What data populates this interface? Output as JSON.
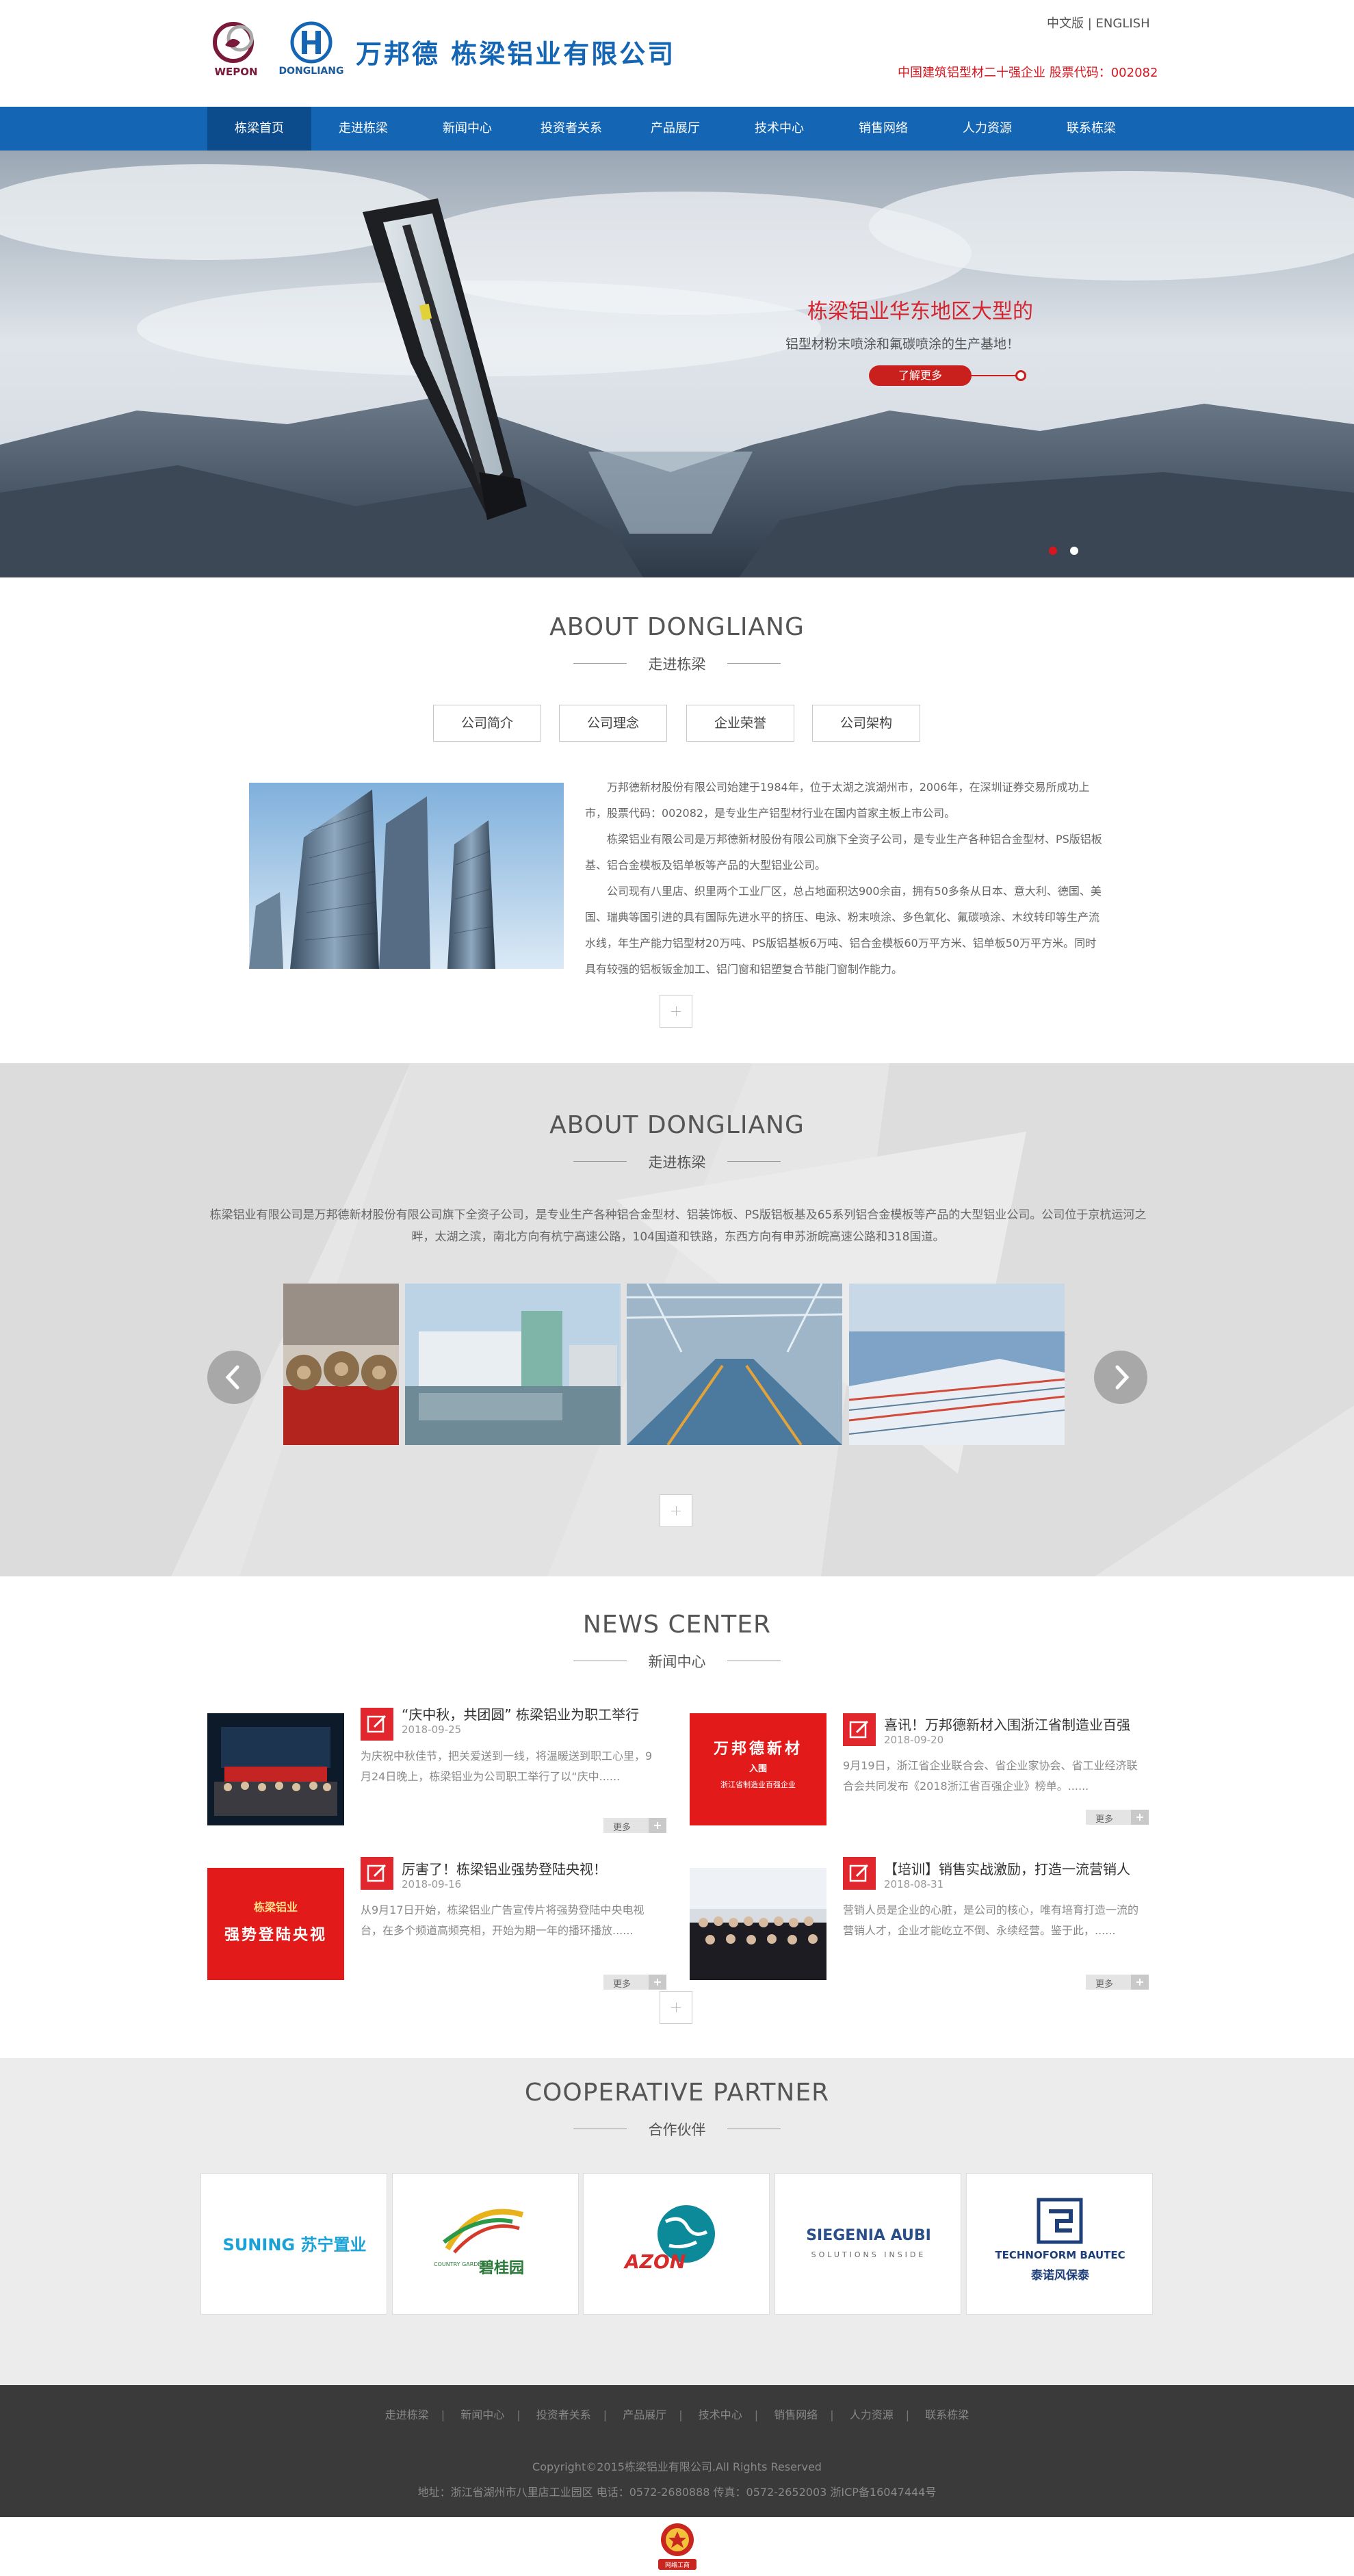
{
  "header": {
    "logo_wepon_text": "WEPON",
    "logo_dongliang_text": "DONGLIANG",
    "brand_text": "万邦德  栋梁铝业有限公司",
    "lang_cn": "中文版",
    "lang_sep": "|",
    "lang_en": "ENGLISH",
    "stock_text": "中国建筑铝型材二十强企业 股票代码：002082"
  },
  "nav": {
    "items": [
      "栋梁首页",
      "走进栋梁",
      "新闻中心",
      "投资者关系",
      "产品展厅",
      "技术中心",
      "销售网络",
      "人力资源",
      "联系栋梁"
    ],
    "active_index": 0
  },
  "banner": {
    "title": "栋梁铝业华东地区大型的",
    "subtitle": "铝型材粉末喷涂和氟碳喷涂的生产基地！",
    "button_label": "了解更多",
    "slide_count": 2,
    "active_slide": 1
  },
  "about": {
    "title_en": "ABOUT DONGLIANG",
    "title_cn": "走进栋梁",
    "tabs": [
      "公司简介",
      "公司理念",
      "企业荣誉",
      "公司架构"
    ],
    "paragraphs": [
      "万邦德新材股份有限公司始建于1984年，位于太湖之滨湖州市，2006年，在深圳证券交易所成功上市，股票代码：002082，是专业生产铝型材行业在国内首家主板上市公司。",
      "栋梁铝业有限公司是万邦德新材股份有限公司旗下全资子公司，是专业生产各种铝合金型材、PS版铝板基、铝合金模板及铝单板等产品的大型铝业公司。",
      "公司现有八里店、织里两个工业厂区，总占地面积达900余亩，拥有50多条从日本、意大利、德国、美国、瑞典等国引进的具有国际先进水平的挤压、电泳、粉末喷涂、多色氧化、氟碳喷涂、木纹转印等生产流水线，年生产能力铝型材20万吨、PS版铝基板6万吨、铝合金模板60万平方米、铝单板50万平方米。同时具有较强的铝板钣金加工、铝门窗和铝塑复合节能门窗制作能力。"
    ]
  },
  "about2": {
    "title_en": "ABOUT DONGLIANG",
    "title_cn": "走进栋梁",
    "text": "栋梁铝业有限公司是万邦德新材股份有限公司旗下全资子公司，是专业生产各种铝合金型材、铝装饰板、PS版铝板基及65系列铝合金模板等产品的大型铝业公司。公司位于京杭运河之畔，太湖之滨，南北方向有杭宁高速公路，104国道和铁路，东西方向有申苏浙皖高速公路和318国道。"
  },
  "news": {
    "title_en": "NEWS CENTER",
    "title_cn": "新闻中心",
    "more_label": "更多",
    "items": [
      {
        "title": "“庆中秋，共团圆” 栋梁铝业为职工举行",
        "date": "2018-09-25",
        "desc": "为庆祝中秋佳节，把关爱送到一线，将温暖送到职工心里，9月24日晚上，栋梁铝业为公司职工举行了以“庆中......"
      },
      {
        "title": "喜讯！万邦德新材入围浙江省制造业百强",
        "date": "2018-09-20",
        "desc": "9月19日，浙江省企业联合会、省企业家协会、省工业经济联合会共同发布《2018浙江省百强企业》榜单。......",
        "thumb_line1": "万邦德新材",
        "thumb_line2": "入围",
        "thumb_line3": "浙江省制造业百强企业"
      },
      {
        "title": "厉害了！栋梁铝业强势登陆央视！",
        "date": "2018-09-16",
        "desc": "从9月17日开始，栋梁铝业广告宣传片将强势登陆中央电视台，在多个频道高频亮相，开始为期一年的播环播放......",
        "thumb_line1": "栋梁铝业",
        "thumb_line2": "强势登陆央视"
      },
      {
        "title": "【培训】销售实战激励，打造一流营销人",
        "date": "2018-08-31",
        "desc": "营销人员是企业的心脏，是公司的核心，唯有培育打造一流的营销人才，企业才能屹立不倒、永续经营。鉴于此，......"
      }
    ]
  },
  "partners": {
    "title_en": "COOPERATIVE PARTNER",
    "title_cn": "合作伙伴",
    "items": [
      {
        "latin": "SUNING",
        "cn": "苏宁置业"
      },
      {
        "latin": "COUNTRY GARDEN",
        "cn": "碧桂园"
      },
      {
        "latin": "AZON",
        "cn": ""
      },
      {
        "latin": "SIEGENIA AUBI",
        "cn": "SOLUTIONS INSIDE"
      },
      {
        "latin": "TECHNOFORM BAUTEC",
        "cn": "泰诺风保泰"
      }
    ]
  },
  "footer": {
    "links": [
      "走进栋梁",
      "新闻中心",
      "投资者关系",
      "产品展厅",
      "技术中心",
      "销售网络",
      "人力资源",
      "联系栋梁"
    ],
    "copyright": "Copyright©2015栋梁铝业有限公司.All Rights Reserved",
    "address": "地址：浙江省湖州市八里店工业园区 电话：0572-2680888 传真：0572-2652003 浙ICP备16047444号",
    "badge_text": "网络工商"
  },
  "colors": {
    "brand_blue": "#1466b4",
    "accent_red": "#d8161f",
    "footer_bg": "#3a3a3a"
  }
}
